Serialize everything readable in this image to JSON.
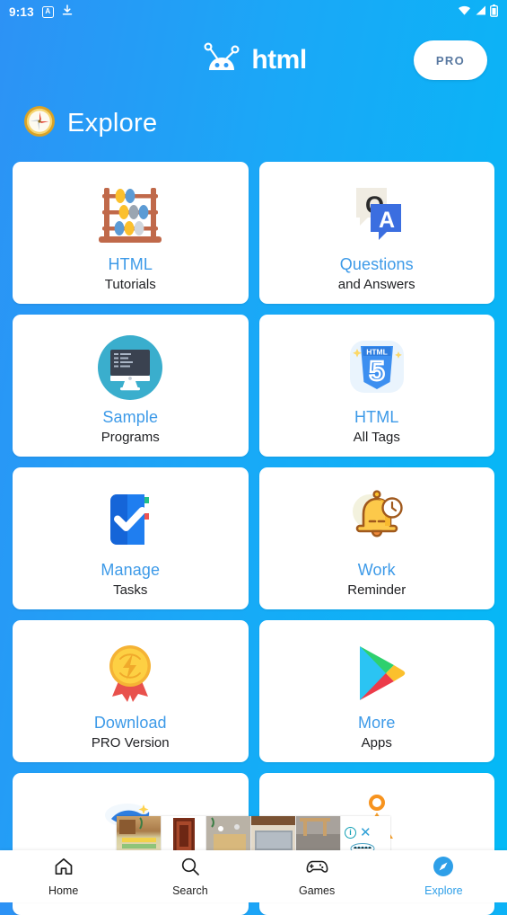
{
  "statusbar": {
    "time": "9:13",
    "badge_letter": "A",
    "icons": [
      "app-badge-icon",
      "download-icon",
      "wifi-icon",
      "signal-icon",
      "battery-icon"
    ]
  },
  "appbar": {
    "logo_icon": "android-robot-icon",
    "logo_text": "html",
    "pro_label": "PRO"
  },
  "section": {
    "icon": "compass-icon",
    "title": "Explore"
  },
  "cards": [
    {
      "icon": "abacus-icon",
      "title": "HTML",
      "subtitle": "Tutorials"
    },
    {
      "icon": "qa-bubbles-icon",
      "title": "Questions",
      "subtitle": "and Answers"
    },
    {
      "icon": "code-monitor-icon",
      "title": "Sample",
      "subtitle": "Programs"
    },
    {
      "icon": "html5-shield-icon",
      "title": "HTML",
      "subtitle": "All Tags"
    },
    {
      "icon": "check-book-icon",
      "title": "Manage",
      "subtitle": "Tasks"
    },
    {
      "icon": "bell-clock-icon",
      "title": "Work",
      "subtitle": "Reminder"
    },
    {
      "icon": "medal-icon",
      "title": "Download",
      "subtitle": "PRO Version"
    },
    {
      "icon": "play-store-icon",
      "title": "More",
      "subtitle": "Apps"
    },
    {
      "icon": "cloud-bird-icon",
      "title": "",
      "subtitle": ""
    },
    {
      "icon": "orange-person-icon",
      "title": "",
      "subtitle": ""
    }
  ],
  "ad": {
    "info_label": "i",
    "close_label": "✕"
  },
  "bottomnav": {
    "items": [
      {
        "icon": "home-icon",
        "label": "Home",
        "active": false
      },
      {
        "icon": "search-icon",
        "label": "Search",
        "active": false
      },
      {
        "icon": "gamepad-icon",
        "label": "Games",
        "active": false
      },
      {
        "icon": "compass-icon",
        "label": "Explore",
        "active": true
      }
    ]
  },
  "colors": {
    "bg_left": "#2d92f5",
    "bg_right": "#03baf6",
    "card_bg": "#ffffff",
    "card_title": "#3d9ae8",
    "card_sub": "#202124",
    "accent": "#2e9fe8"
  }
}
